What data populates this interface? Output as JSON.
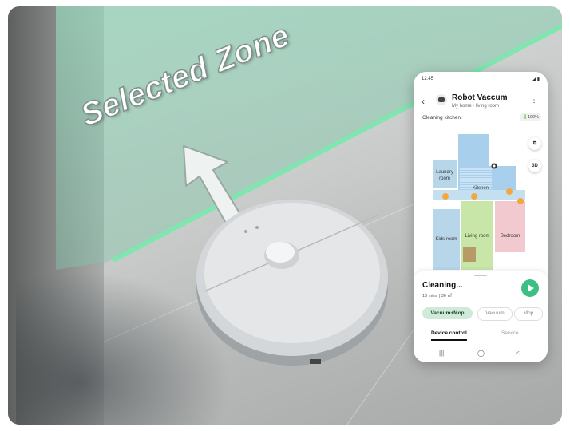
{
  "overlay": {
    "zone_label": "Selected Zone"
  },
  "phone": {
    "status_time": "12:45",
    "status_icons": "◢ ▮",
    "back_icon": "chevron-left-icon",
    "device_name": "Robot Vaccum",
    "location": "My home · living room",
    "more_icon": "more-vertical-icon",
    "status_message": "Cleaning kitchen.",
    "battery": "🔋100%",
    "map_controls": {
      "layers_icon": "layers-icon",
      "view_3d": "3D"
    },
    "rooms": [
      {
        "label": "Laundry room",
        "color": "#b7d6ea"
      },
      {
        "label": "Kitchen",
        "color": "#a8d0ec"
      },
      {
        "label": "Kids room",
        "color": "#b7d6ea"
      },
      {
        "label": "Living room",
        "color": "#c7e6a8"
      },
      {
        "label": "Bedroom",
        "color": "#f2c9cf"
      }
    ],
    "sheet": {
      "title": "Cleaning...",
      "subtitle": "13 mins | 30 ㎡",
      "play_icon": "play-icon",
      "modes": [
        "Vacuum+Mop",
        "Vacuum",
        "Mop"
      ],
      "tabs": [
        "Device control",
        "Service"
      ]
    },
    "nav": {
      "recents_icon": "|||",
      "home_icon": "◯",
      "back_icon": "<"
    }
  },
  "colors": {
    "accent_green": "#3bbf83",
    "zone_green": "#7fe6b0"
  }
}
